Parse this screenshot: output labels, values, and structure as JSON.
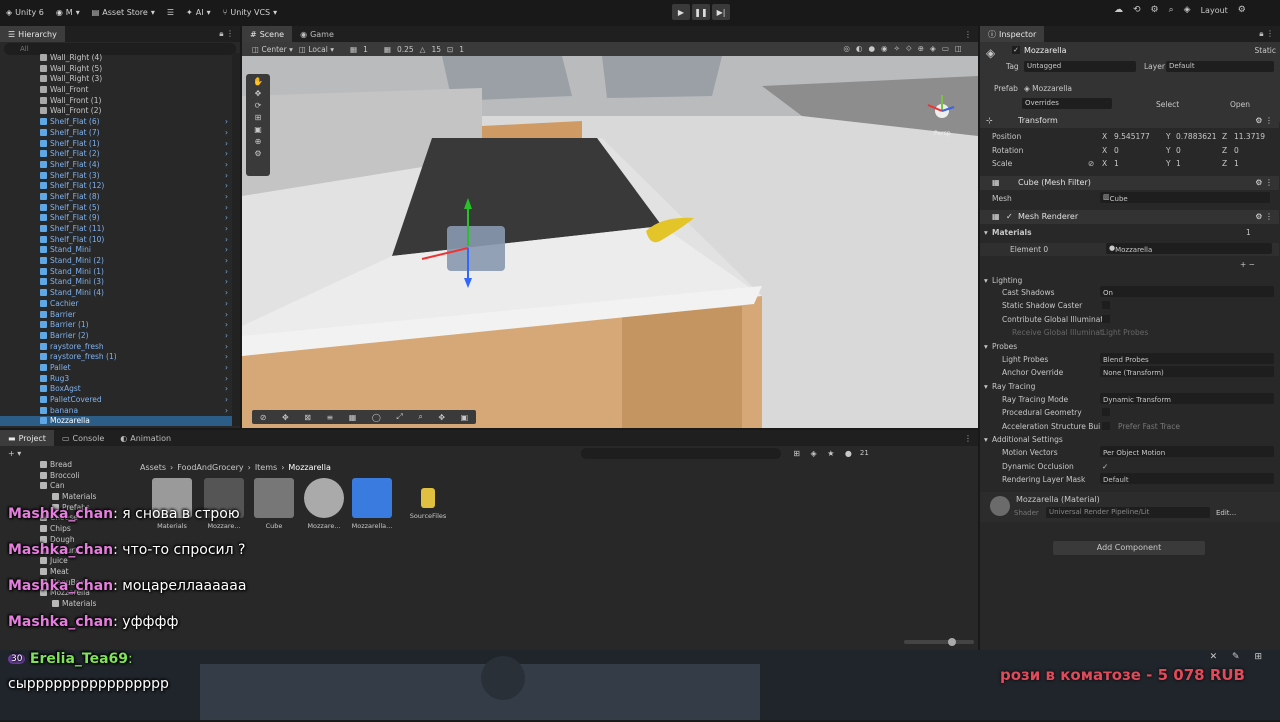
{
  "topbar": {
    "unity_label": "Unity 6",
    "account_label": "M",
    "asset_store_label": "Asset Store",
    "ai_label": "AI",
    "vcs_label": "Unity VCS",
    "layout_label": "Layout"
  },
  "hierarchy": {
    "tab_label": "Hierarchy",
    "search_placeholder": "All",
    "items": [
      {
        "label": "Wall_Right (4)",
        "prefab": false
      },
      {
        "label": "Wall_Right (5)",
        "prefab": false
      },
      {
        "label": "Wall_Right (3)",
        "prefab": false
      },
      {
        "label": "Wall_Front",
        "prefab": false
      },
      {
        "label": "Wall_Front (1)",
        "prefab": false
      },
      {
        "label": "Wall_Front (2)",
        "prefab": false
      },
      {
        "label": "Shelf_Flat (6)",
        "prefab": true
      },
      {
        "label": "Shelf_Flat (7)",
        "prefab": true
      },
      {
        "label": "Shelf_Flat (1)",
        "prefab": true
      },
      {
        "label": "Shelf_Flat (2)",
        "prefab": true
      },
      {
        "label": "Shelf_Flat (4)",
        "prefab": true
      },
      {
        "label": "Shelf_Flat (3)",
        "prefab": true
      },
      {
        "label": "Shelf_Flat (12)",
        "prefab": true
      },
      {
        "label": "Shelf_Flat (8)",
        "prefab": true
      },
      {
        "label": "Shelf_Flat (5)",
        "prefab": true
      },
      {
        "label": "Shelf_Flat (9)",
        "prefab": true
      },
      {
        "label": "Shelf_Flat (11)",
        "prefab": true
      },
      {
        "label": "Shelf_Flat (10)",
        "prefab": true
      },
      {
        "label": "Stand_Mini",
        "prefab": true
      },
      {
        "label": "Stand_Mini (2)",
        "prefab": true
      },
      {
        "label": "Stand_Mini (1)",
        "prefab": true
      },
      {
        "label": "Stand_Mini (3)",
        "prefab": true
      },
      {
        "label": "Stand_Mini (4)",
        "prefab": true
      },
      {
        "label": "Cachier",
        "prefab": true
      },
      {
        "label": "Barrier",
        "prefab": true
      },
      {
        "label": "Barrier (1)",
        "prefab": true
      },
      {
        "label": "Barrier (2)",
        "prefab": true
      },
      {
        "label": "raystore_fresh",
        "prefab": true
      },
      {
        "label": "raystore_fresh (1)",
        "prefab": true
      },
      {
        "label": "Pallet",
        "prefab": true
      },
      {
        "label": "Rug3",
        "prefab": true
      },
      {
        "label": "BoxAgst",
        "prefab": true
      },
      {
        "label": "PalletCovered",
        "prefab": true
      },
      {
        "label": "banana",
        "prefab": true
      },
      {
        "label": "Mozzarella",
        "prefab": true,
        "selected": true
      }
    ]
  },
  "scene": {
    "tab_scene": "Scene",
    "tab_game": "Game",
    "pivot_label": "Center",
    "space_label": "Local",
    "grid_value": "1",
    "snap_value": "0.25",
    "angle_value": "15",
    "scale_value": "1",
    "gizmo_persp_label": "Persp"
  },
  "inspector": {
    "tab_label": "Inspector",
    "object_name": "Mozzarella",
    "static_label": "Static",
    "tag_label": "Tag",
    "tag_value": "Untagged",
    "layer_label": "Layer",
    "layer_value": "Default",
    "prefab_label": "Prefab",
    "prefab_value": "Mozzarella",
    "overrides_label": "Overrides",
    "select_label": "Select",
    "open_label": "Open",
    "transform": {
      "title": "Transform",
      "position_label": "Position",
      "rotation_label": "Rotation",
      "scale_label": "Scale",
      "position": {
        "x": "9.545177",
        "y": "0.7883621",
        "z": "11.3719"
      },
      "rotation": {
        "x": "0",
        "y": "0",
        "z": "0"
      },
      "scale": {
        "x": "1",
        "y": "1",
        "z": "1"
      }
    },
    "mesh_filter": {
      "title": "Cube (Mesh Filter)",
      "mesh_label": "Mesh",
      "mesh_value": "Cube"
    },
    "mesh_renderer": {
      "title": "Mesh Renderer",
      "materials_label": "Materials",
      "materials_count": "1",
      "element_label": "Element 0",
      "element_value": "Mozzarella",
      "lighting_label": "Lighting",
      "cast_shadows_label": "Cast Shadows",
      "cast_shadows_value": "On",
      "static_shadow_label": "Static Shadow Caster",
      "contribute_gi_label": "Contribute Global Illuminati",
      "receive_gi_label": "Receive Global Illuminat",
      "receive_gi_value": "Light Probes",
      "probes_label": "Probes",
      "light_probes_label": "Light Probes",
      "light_probes_value": "Blend Probes",
      "anchor_label": "Anchor Override",
      "anchor_value": "None (Transform)",
      "ray_tracing_label": "Ray Tracing",
      "ray_mode_label": "Ray Tracing Mode",
      "ray_mode_value": "Dynamic Transform",
      "procedural_label": "Procedural Geometry",
      "accel_label": "Acceleration Structure Bui",
      "accel_value": "Prefer Fast Trace",
      "additional_label": "Additional Settings",
      "motion_label": "Motion Vectors",
      "motion_value": "Per Object Motion",
      "occlusion_label": "Dynamic Occlusion",
      "render_layer_label": "Rendering Layer Mask",
      "render_layer_value": "Default"
    },
    "material": {
      "title": "Mozzarella (Material)",
      "shader_label": "Shader",
      "shader_value": "Universal Render Pipeline/Lit",
      "edit_label": "Edit..."
    },
    "add_component_label": "Add Component"
  },
  "project": {
    "tab_project": "Project",
    "tab_console": "Console",
    "tab_animation": "Animation",
    "badge_count": "21",
    "breadcrumb": [
      "Assets",
      "FoodAndGrocery",
      "Items",
      "Mozzarella"
    ],
    "folders": [
      "Bread",
      "Broccoli",
      "Can",
      "Materials",
      "Prefabs",
      "Cheese",
      "Chips",
      "Dough",
      "Joghurt",
      "Juice",
      "Meat",
      "MenuBowl",
      "Mozzarella",
      "Materials"
    ],
    "assets": [
      "Materials",
      "Mozzare...",
      "Cube",
      "Mozzare...",
      "Mozzarella...",
      "SourceFiles"
    ]
  },
  "chat": {
    "messages": [
      {
        "name": "Mashka_chan",
        "text": "я снова в строю"
      },
      {
        "name": "Mashka_chan",
        "text": "что-то спросил ?"
      },
      {
        "name": "Mashka_chan",
        "text": "моцареллаааааа"
      },
      {
        "name": "Mashka_chan",
        "text": "уфффф"
      }
    ],
    "highlight_badge": "30",
    "highlight_name": "Erelia_Tea69",
    "highlight_text": "сырррррррррррррррр"
  },
  "donation": {
    "text": "рози в коматозе - 5 078 RUB"
  }
}
